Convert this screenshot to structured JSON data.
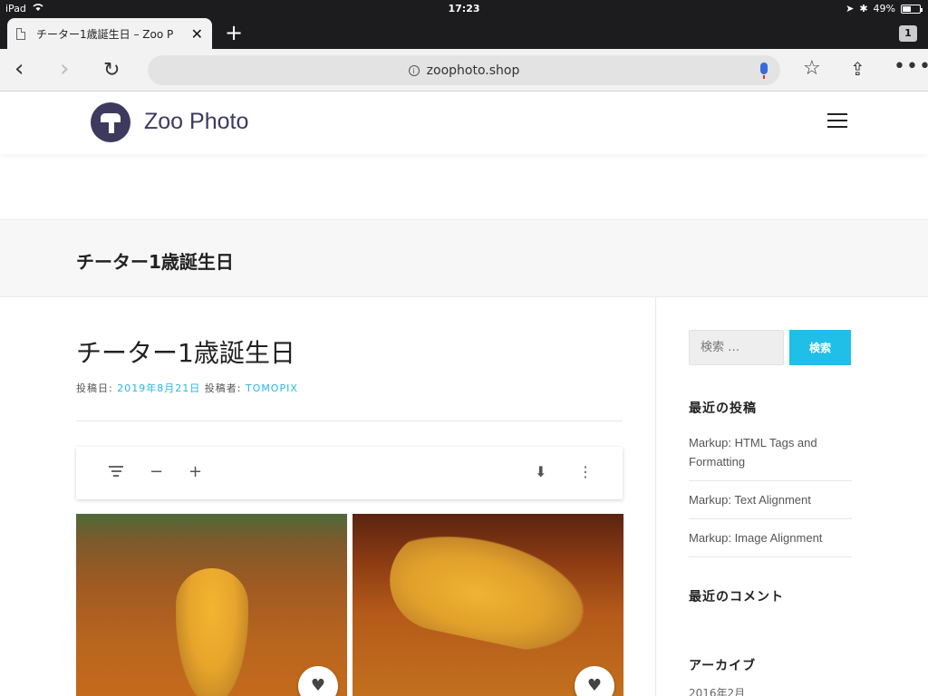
{
  "status_bar": {
    "device": "iPad",
    "time": "17:23",
    "battery": "49%",
    "battery_level": 0.49
  },
  "browser": {
    "tab_title": "チーター1歳誕生日 – Zoo P",
    "tab_count": "1",
    "url": "zoophoto.shop",
    "icons": {
      "back": "chevron-left-icon",
      "forward": "chevron-right-icon",
      "reload": "reload-icon",
      "bookmark": "star-icon",
      "share": "share-icon",
      "more": "more-icon"
    }
  },
  "site": {
    "title": "Zoo Photo"
  },
  "page": {
    "band_title": "チーター1歳誕生日",
    "post_title": "チーター1歳誕生日",
    "meta_posted_label": "投稿日:",
    "meta_date": "2019年8月21日",
    "meta_author_label": "投稿者:",
    "meta_author": "TOMOPIX"
  },
  "gallery": {
    "toolbar_icons": [
      "filter-icon",
      "minus-icon",
      "plus-icon",
      "download-icon",
      "kebab-icon"
    ]
  },
  "sidebar": {
    "search_placeholder": "検索 …",
    "search_button": "検索",
    "recent_posts_title": "最近の投稿",
    "recent_posts": [
      "Markup: HTML Tags and Formatting",
      "Markup: Text Alignment",
      "Markup: Image Alignment"
    ],
    "recent_comments_title": "最近のコメント",
    "archive_title": "アーカイブ",
    "archive_first": "2016年2月"
  },
  "colors": {
    "accent": "#1fbfe8",
    "brand": "#3d3a5e",
    "link": "#23b8e6"
  }
}
